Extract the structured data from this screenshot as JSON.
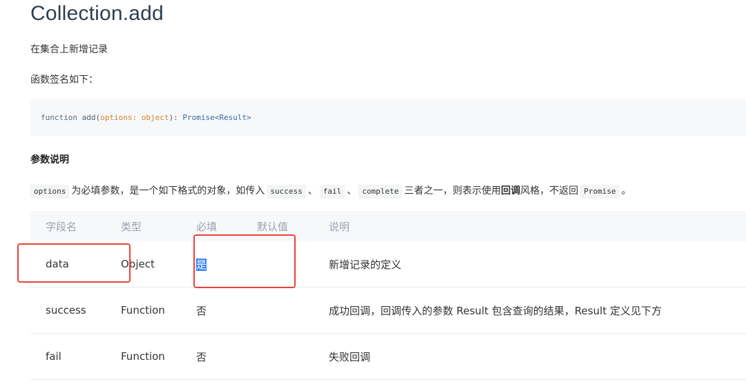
{
  "title": "Collection.add",
  "intro": "在集合上新增记录",
  "signature_label": "函数签名如下：",
  "code": {
    "keyword": "function",
    "fn_name": " add(",
    "param_name": "options",
    "sep": ": ",
    "param_type": "object",
    "close": "): ",
    "return_type": "Promise<Result>"
  },
  "section_heading": "参数说明",
  "description": {
    "code_options": "options",
    "text1": "为必填参数，是一个如下格式的对象，如传入",
    "code_success": "success",
    "sep1": "、",
    "code_fail": "fail",
    "sep2": "、",
    "code_complete": "complete",
    "text2": "三者之一，则表示使用",
    "bold": "回调",
    "text3": "风格，不返回",
    "code_promise": "Promise",
    "end": "。"
  },
  "table": {
    "headers": [
      "字段名",
      "类型",
      "必填",
      "默认值",
      "说明"
    ],
    "rows": [
      {
        "name": "data",
        "type": "Object",
        "required": "是",
        "default": "",
        "desc": "新增记录的定义"
      },
      {
        "name": "success",
        "type": "Function",
        "required": "否",
        "default": "",
        "desc": "成功回调，回调传入的参数 Result 包含查询的结果，Result 定义见下方"
      },
      {
        "name": "fail",
        "type": "Function",
        "required": "否",
        "default": "",
        "desc": "失败回调"
      }
    ]
  },
  "colors": {
    "annotation_box": "#e8413b",
    "selection": "#3b82f6",
    "code_bg": "#f6f8fa",
    "header_bg": "#f7f8fa"
  }
}
